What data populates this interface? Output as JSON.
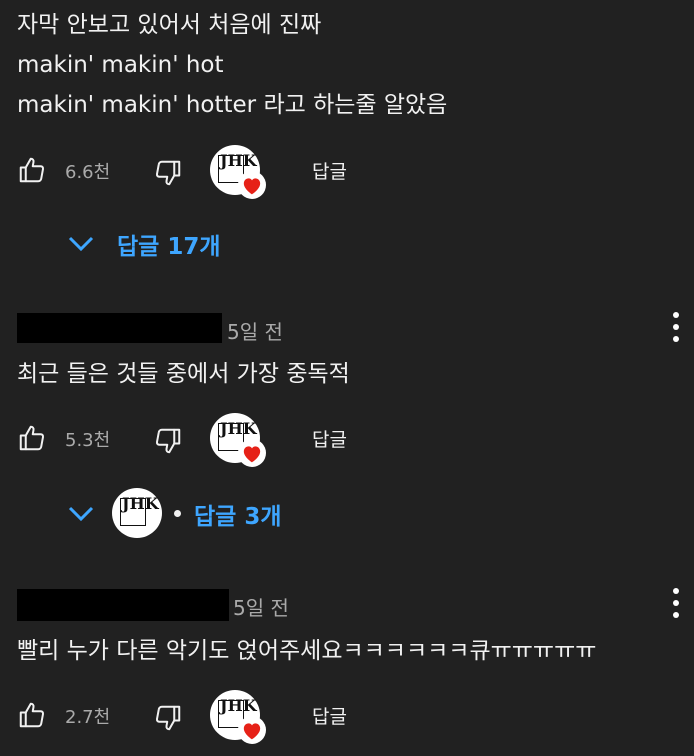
{
  "comments": [
    {
      "lines": [
        "자막 안보고 있어서 처음에 진짜",
        "makin' makin' hot",
        "makin' makin' hotter 라고 하는줄 알았음"
      ],
      "likes": "6.6천",
      "reply_label": "답글",
      "replies_toggle": "답글 17개"
    },
    {
      "time": "5일 전",
      "text": "최근 들은 것들 중에서 가장 중독적",
      "likes": "5.3천",
      "reply_label": "답글",
      "replies_toggle": "답글 3개"
    },
    {
      "time": "5일 전",
      "text": "빨리 누가 다른 악기도 얹어주세요ㅋㅋㅋㅋㅋㅋ큐ㅠㅠㅠㅠㅠ",
      "likes": "2.7천",
      "reply_label": "답글"
    }
  ],
  "creator": {
    "logo_text": "JHK",
    "logo_subtext": "DRUM"
  },
  "icons": {
    "like": "thumb-up-icon",
    "dislike": "thumb-down-icon",
    "expand": "chevron-down-icon",
    "heart": "heart-icon",
    "more": "kebab-menu-icon"
  },
  "colors": {
    "background": "#212121",
    "text": "#f1f1f1",
    "secondary": "#aaaaaa",
    "link": "#3ea6ff",
    "heart": "#e62117"
  }
}
